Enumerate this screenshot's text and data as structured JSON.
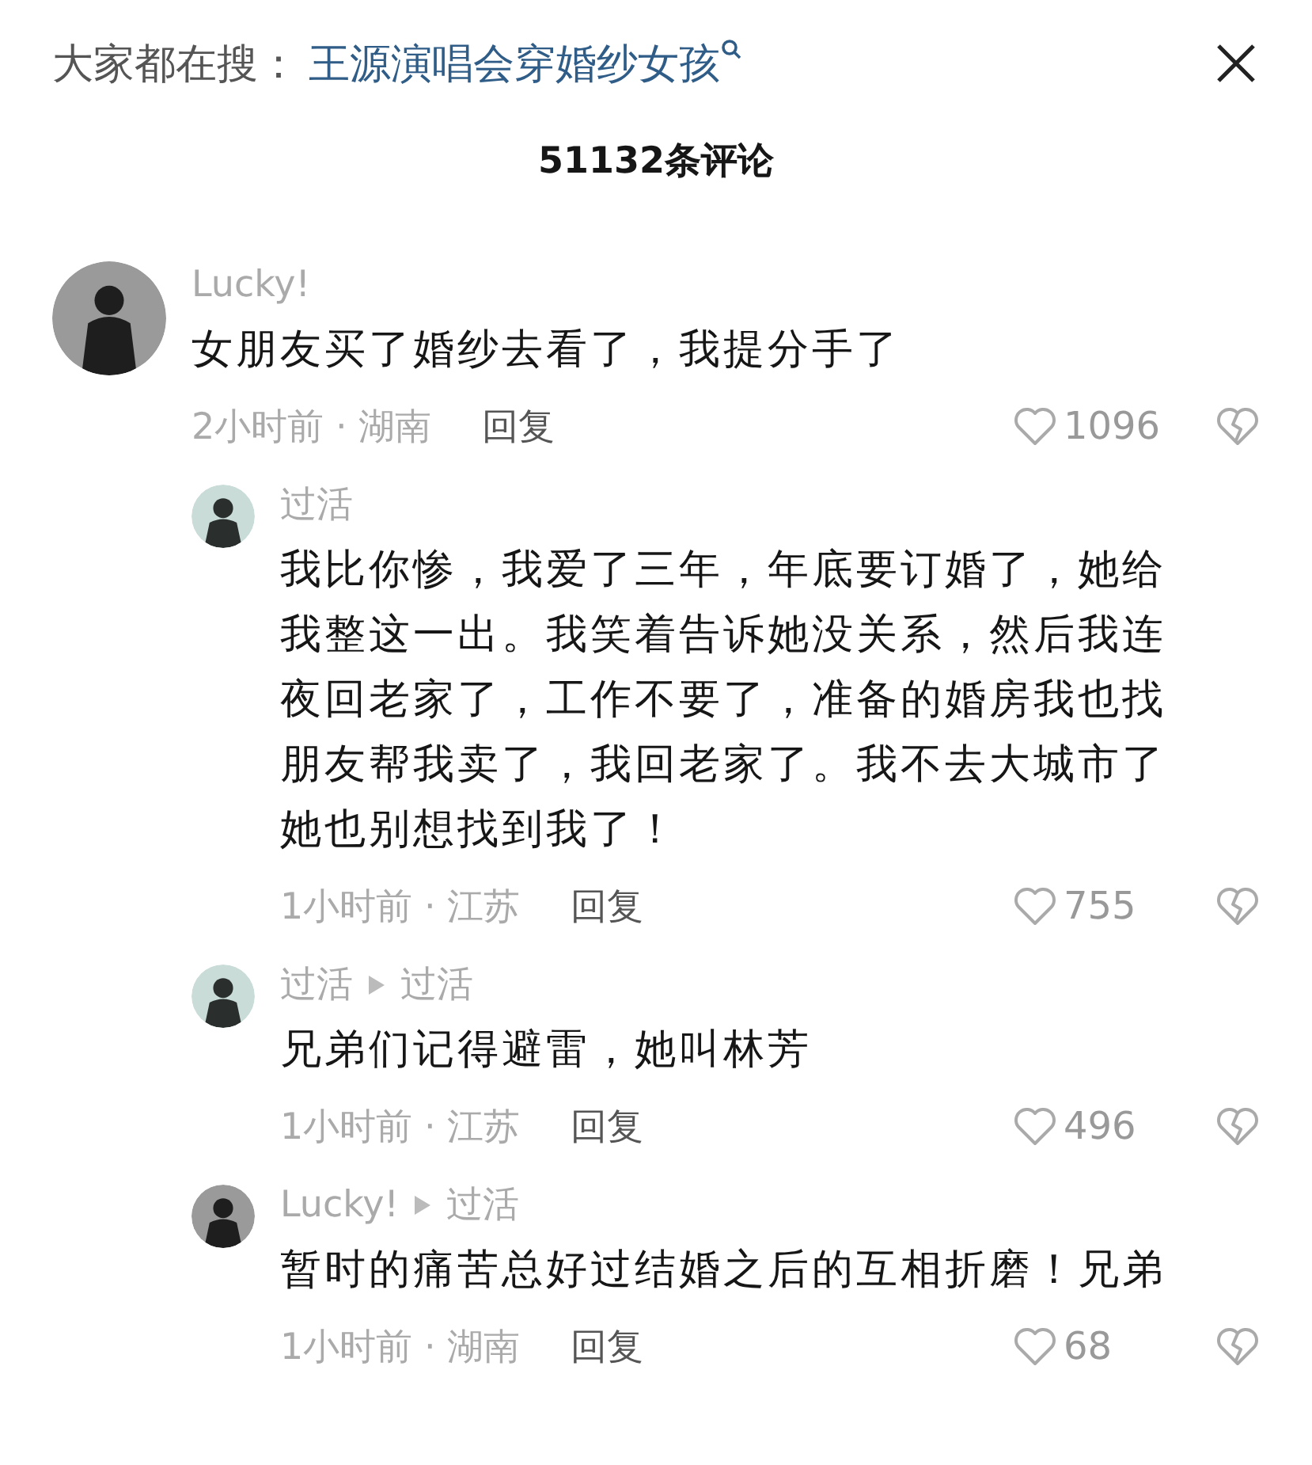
{
  "trending": {
    "label": "大家都在搜：",
    "query": "王源演唱会穿婚纱女孩"
  },
  "comment_count": "51132条评论",
  "comments": [
    {
      "author": "Lucky!",
      "kind": "dark",
      "text": "女朋友买了婚纱去看了，我提分手了",
      "time": "2小时前 · 湖南",
      "reply": "回复",
      "likes": "1096",
      "replies": [
        {
          "author": "过活",
          "kind": "light",
          "text": "我比你惨，我爱了三年，年底要订婚了，她给我整这一出。我笑着告诉她没关系，然后我连夜回老家了，工作不要了，准备的婚房我也找朋友帮我卖了，我回老家了。我不去大城市了她也别想找到我了！",
          "time": "1小时前 · 江苏",
          "reply": "回复",
          "likes": "755"
        },
        {
          "author": "过活",
          "reply_to": "过活",
          "kind": "light",
          "text": "兄弟们记得避雷，她叫林芳",
          "time": "1小时前 · 江苏",
          "reply": "回复",
          "likes": "496"
        },
        {
          "author": "Lucky!",
          "reply_to": "过活",
          "kind": "dark",
          "text": "暂时的痛苦总好过结婚之后的互相折磨！兄弟",
          "time": "1小时前 · 湖南",
          "reply": "回复",
          "likes": "68"
        }
      ]
    }
  ]
}
